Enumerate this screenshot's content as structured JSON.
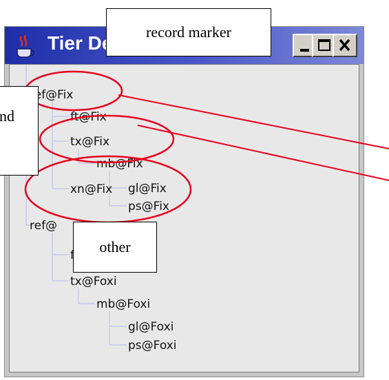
{
  "window": {
    "title": "Tier De",
    "controls": [
      "minimize",
      "maximize",
      "close"
    ],
    "title_gradient_start": "#1e2ea8",
    "title_gradient_end": "#7d89d8"
  },
  "tree": {
    "nodes": [
      {
        "label": "ref@Fix",
        "depth": 0
      },
      {
        "label": "ft@Fix",
        "depth": 1
      },
      {
        "label": "tx@Fix",
        "depth": 1
      },
      {
        "label": "mb@Fix",
        "depth": 2
      },
      {
        "label": "gl@Fix",
        "depth": 3
      },
      {
        "label": "ps@Fix",
        "depth": 3
      },
      {
        "label": "xn@Fix",
        "depth": 1
      },
      {
        "label": "ref@",
        "depth": 0
      },
      {
        "label": "f",
        "depth": 1
      },
      {
        "label": "tx@Foxi",
        "depth": 1
      },
      {
        "label": "mb@Foxi",
        "depth": 2
      },
      {
        "label": "gl@Foxi",
        "depth": 3
      },
      {
        "label": "ps@Foxi",
        "depth": 3
      }
    ]
  },
  "callouts": {
    "record_marker": "record marker",
    "left_partial": "nd",
    "other": "other"
  },
  "annotation_color": "#e8001c"
}
